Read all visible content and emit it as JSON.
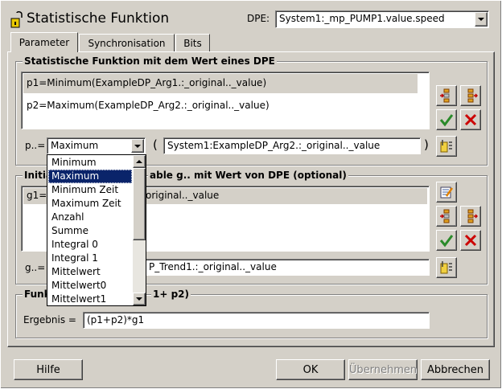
{
  "window": {
    "title": "Statistische Funktion",
    "dpe_label": "DPE:",
    "dpe_value": "System1:_mp_PUMP1.value.speed"
  },
  "tabs": [
    {
      "label": "Parameter",
      "active": true
    },
    {
      "label": "Synchronisation",
      "active": false
    },
    {
      "label": "Bits",
      "active": false
    }
  ],
  "group1": {
    "title": "Statistische Funktion mit dem Wert eines DPE",
    "items": [
      "p1=Minimum(ExampleDP_Arg1.:_original.._value)",
      "p2=Maximum(ExampleDP_Arg2.:_original.._value)"
    ],
    "p_label": "p..=",
    "p_select_value": "Maximum",
    "dpe_field": "System1:ExampleDP_Arg2.:_original.._value",
    "open_paren": "(",
    "close_paren": ")"
  },
  "group2": {
    "title_left": "Initia",
    "title_right": "able g.. mit Wert von DPE (optional)",
    "list_row_prefix": "g1=",
    "list_row_suffix": "original.._value",
    "g_label": "g..=",
    "g_field_visible": "P_Trend1.:_original.._value"
  },
  "group3": {
    "title_left": "Funk",
    "title_right": "1+ p2)",
    "result_label": "Ergebnis =",
    "result_value": "(p1+p2)*g1"
  },
  "dropdown": {
    "options": [
      "Minimum",
      "Maximum",
      "Minimum Zeit",
      "Maximum Zeit",
      "Anzahl",
      "Summe",
      "Integral 0",
      "Integral 1",
      "Mittelwert",
      "Mittelwert0",
      "Mittelwert1"
    ],
    "selected": "Maximum"
  },
  "buttons": {
    "help": "Hilfe",
    "ok": "OK",
    "apply": "Übernehmen",
    "cancel": "Abbrechen"
  },
  "icons": {
    "add": "add-row-icon",
    "remove": "remove-row-icon",
    "confirm": "checkmark-icon",
    "delete": "x-icon",
    "edit": "edit-icon",
    "dpe_select": "dpe-select-icon"
  },
  "colors": {
    "selection": "#0a246a",
    "list_selected_row": "#d4d0c8",
    "confirm_green": "#2a8a2a",
    "delete_red": "#cc0000"
  }
}
